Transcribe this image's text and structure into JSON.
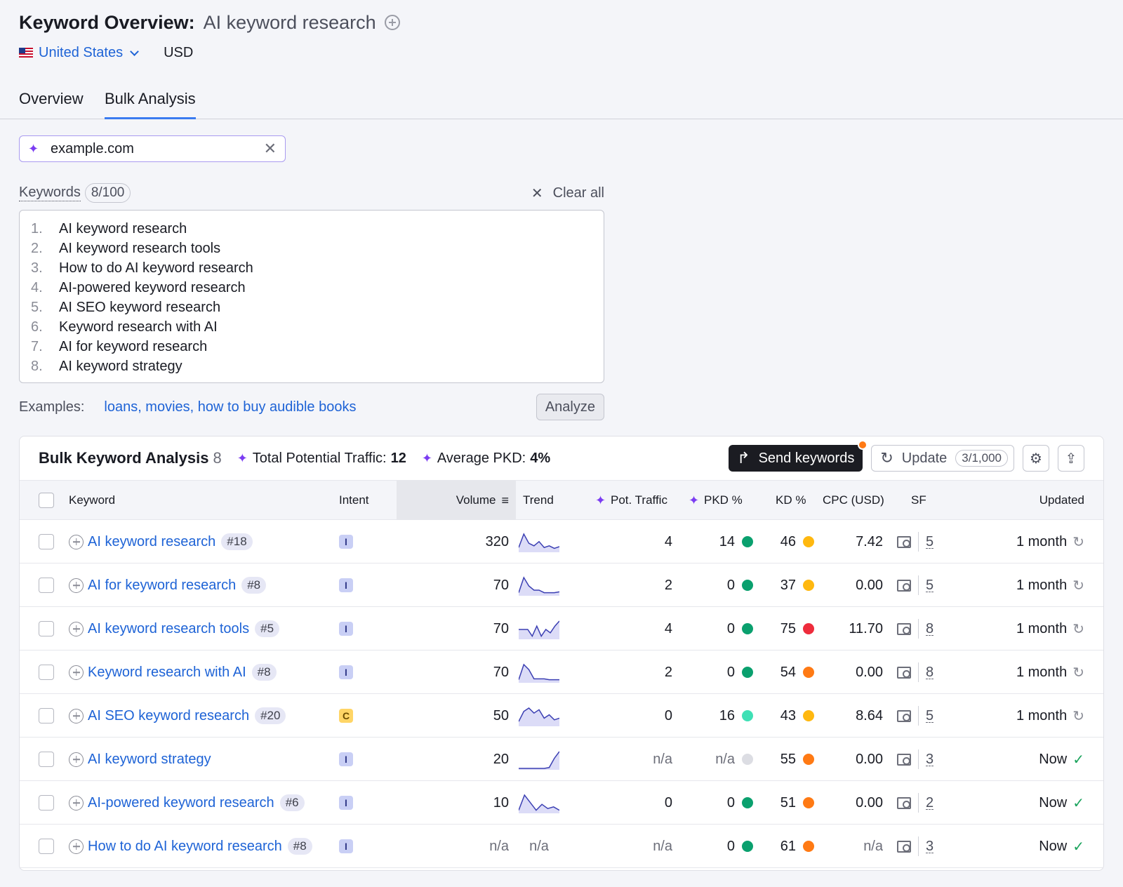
{
  "header": {
    "title": "Keyword Overview:",
    "keyword": "AI keyword research",
    "country": "United States",
    "currency": "USD"
  },
  "tabs": [
    {
      "label": "Overview",
      "active": false
    },
    {
      "label": "Bulk Analysis",
      "active": true
    }
  ],
  "domain_input": {
    "value": "example.com"
  },
  "keywords_panel": {
    "label": "Keywords",
    "count": "8/100",
    "clear_label": "Clear all",
    "items": [
      {
        "num": "1.",
        "text": "AI keyword research"
      },
      {
        "num": "2.",
        "text": "AI keyword research tools"
      },
      {
        "num": "3.",
        "text": "How to do AI keyword research"
      },
      {
        "num": "4.",
        "text": "AI-powered keyword research"
      },
      {
        "num": "5.",
        "text": "AI SEO keyword research"
      },
      {
        "num": "6.",
        "text": "Keyword research with AI"
      },
      {
        "num": "7.",
        "text": "AI for keyword research"
      },
      {
        "num": "8.",
        "text": "AI keyword strategy"
      }
    ]
  },
  "examples": {
    "label": "Examples:",
    "links": "loans, movies, how to buy audible books",
    "analyze_label": "Analyze"
  },
  "table": {
    "title": "Bulk Keyword Analysis",
    "count": "8",
    "total_traffic_label": "Total Potential Traffic:",
    "total_traffic_value": "12",
    "avg_pkd_label": "Average PKD:",
    "avg_pkd_value": "4%",
    "send_label": "Send keywords",
    "update_label": "Update",
    "update_count": "3/1,000",
    "columns": {
      "keyword": "Keyword",
      "intent": "Intent",
      "volume": "Volume",
      "trend": "Trend",
      "pot_traffic": "Pot. Traffic",
      "pkd": "PKD %",
      "kd": "KD %",
      "cpc": "CPC (USD)",
      "sf": "SF",
      "updated": "Updated"
    },
    "colors": {
      "green": "#0aa06e",
      "teal": "#3fe0b5",
      "yellow": "#ffb80f",
      "orange": "#ff7a14",
      "red": "#ee2c3c",
      "gray": "#dcdde3"
    },
    "rows": [
      {
        "keyword": "AI keyword research",
        "rank": "#18",
        "intent": "I",
        "volume": "320",
        "trend": [
          0.2,
          1,
          0.45,
          0.3,
          0.55,
          0.2,
          0.3,
          0.15,
          0.25
        ],
        "trend_text": "",
        "pot_traffic": "4",
        "pkd": "14",
        "pkd_color": "green",
        "kd": "46",
        "kd_color": "yellow",
        "cpc": "7.42",
        "sf": "5",
        "updated": "1 month",
        "fresh": false
      },
      {
        "keyword": "AI for keyword research",
        "rank": "#8",
        "intent": "I",
        "volume": "70",
        "trend": [
          0.1,
          1,
          0.5,
          0.25,
          0.25,
          0.1,
          0.1,
          0.1,
          0.15
        ],
        "trend_text": "",
        "pot_traffic": "2",
        "pkd": "0",
        "pkd_color": "green",
        "kd": "37",
        "kd_color": "yellow",
        "cpc": "0.00",
        "sf": "5",
        "updated": "1 month",
        "fresh": false
      },
      {
        "keyword": "AI keyword research tools",
        "rank": "#5",
        "intent": "I",
        "volume": "70",
        "trend": [
          0.5,
          0.5,
          0.5,
          0.1,
          0.7,
          0.1,
          0.5,
          0.3,
          0.7,
          1
        ],
        "trend_text": "",
        "pot_traffic": "4",
        "pkd": "0",
        "pkd_color": "green",
        "kd": "75",
        "kd_color": "red",
        "cpc": "11.70",
        "sf": "8",
        "updated": "1 month",
        "fresh": false
      },
      {
        "keyword": "Keyword research with AI",
        "rank": "#8",
        "intent": "I",
        "volume": "70",
        "trend": [
          0.1,
          1,
          0.7,
          0.15,
          0.15,
          0.15,
          0.1,
          0.1,
          0.1
        ],
        "trend_text": "",
        "pot_traffic": "2",
        "pkd": "0",
        "pkd_color": "green",
        "kd": "54",
        "kd_color": "orange",
        "cpc": "0.00",
        "sf": "8",
        "updated": "1 month",
        "fresh": false
      },
      {
        "keyword": "AI SEO keyword research",
        "rank": "#20",
        "intent": "C",
        "volume": "50",
        "trend": [
          0.2,
          0.8,
          1,
          0.7,
          0.9,
          0.4,
          0.6,
          0.3,
          0.4
        ],
        "trend_text": "",
        "pot_traffic": "0",
        "pkd": "16",
        "pkd_color": "teal",
        "kd": "43",
        "kd_color": "yellow",
        "cpc": "8.64",
        "sf": "5",
        "updated": "1 month",
        "fresh": false
      },
      {
        "keyword": "AI keyword strategy",
        "rank": "",
        "intent": "I",
        "volume": "20",
        "trend": [
          0,
          0,
          0,
          0,
          0,
          0,
          0.05,
          0.6,
          1
        ],
        "trend_text": "",
        "pot_traffic": "n/a",
        "pkd": "n/a",
        "pkd_color": "gray",
        "kd": "55",
        "kd_color": "orange",
        "cpc": "0.00",
        "sf": "3",
        "updated": "Now",
        "fresh": true
      },
      {
        "keyword": "AI-powered keyword research",
        "rank": "#6",
        "intent": "I",
        "volume": "10",
        "trend": [
          0.1,
          1,
          0.55,
          0.1,
          0.45,
          0.2,
          0.3,
          0.1
        ],
        "trend_text": "",
        "pot_traffic": "0",
        "pkd": "0",
        "pkd_color": "green",
        "kd": "51",
        "kd_color": "orange",
        "cpc": "0.00",
        "sf": "2",
        "updated": "Now",
        "fresh": true
      },
      {
        "keyword": "How to do AI keyword research",
        "rank": "#8",
        "intent": "I",
        "volume": "n/a",
        "trend": [],
        "trend_text": "n/a",
        "pot_traffic": "n/a",
        "pkd": "0",
        "pkd_color": "green",
        "kd": "61",
        "kd_color": "orange",
        "cpc": "n/a",
        "sf": "3",
        "updated": "Now",
        "fresh": true
      }
    ]
  }
}
